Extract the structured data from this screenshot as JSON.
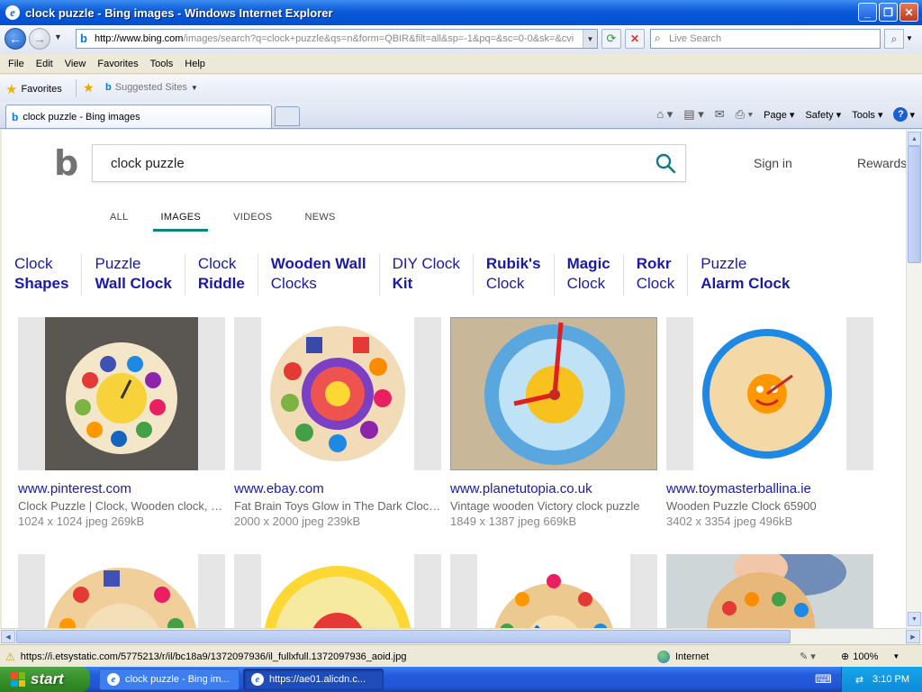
{
  "window": {
    "title": "clock puzzle - Bing images - Windows Internet Explorer",
    "buttons": [
      "minimize",
      "maximize",
      "close"
    ]
  },
  "address_bar": {
    "domain": "http://www.bing.com",
    "path": "/images/search?q=clock+puzzle&qs=n&form=QBIR&filt=all&sp=-1&pq=&sc=0-0&sk=&cvi",
    "live_search_placeholder": "Live Search"
  },
  "menu": [
    "File",
    "Edit",
    "View",
    "Favorites",
    "Tools",
    "Help"
  ],
  "favorites_bar": {
    "favorites_label": "Favorites",
    "suggested_sites": "Suggested Sites"
  },
  "tab": {
    "title": "clock puzzle - Bing images"
  },
  "command_bar": {
    "page": "Page",
    "safety": "Safety",
    "tools": "Tools"
  },
  "bing": {
    "query": "clock puzzle",
    "sign_in": "Sign in",
    "rewards": "Rewards",
    "scopes": [
      "ALL",
      "IMAGES",
      "VIDEOS",
      "NEWS"
    ],
    "active_scope": "IMAGES",
    "related": [
      {
        "line1": "Clock",
        "line2": "Shapes",
        "bold": "line2"
      },
      {
        "line1": "Puzzle",
        "line2": "Wall Clock",
        "bold": "line2"
      },
      {
        "line1": "Clock",
        "line2": "Riddle",
        "bold": "line2"
      },
      {
        "line1": "Wooden Wall",
        "line2": "Clocks",
        "bold": "line1"
      },
      {
        "line1": "DIY Clock",
        "line2": "Kit",
        "bold": "line2"
      },
      {
        "line1": "Rubik's",
        "line2": "Clock",
        "bold": "line1"
      },
      {
        "line1": "Magic",
        "line2": "Clock",
        "bold": "line1"
      },
      {
        "line1": "Rokr",
        "line2": "Clock",
        "bold": "line1"
      },
      {
        "line1": "Puzzle",
        "line2": "Alarm Clock",
        "bold": "line2"
      }
    ],
    "results": [
      {
        "site": "www.pinterest.com",
        "caption": "Clock Puzzle | Clock, Wooden clock, Clock puzzle",
        "meta": "1024 x 1024 jpeg 269kB"
      },
      {
        "site": "www.ebay.com",
        "caption": "Fat Brain Toys Glow in The Dark Clock Puzzle",
        "meta": "2000 x 2000 jpeg 239kB"
      },
      {
        "site": "www.planetutopia.co.uk",
        "caption": "Vintage wooden Victory clock puzzle",
        "meta": "1849 x 1387 jpeg 669kB"
      },
      {
        "site": "www.toymasterballina.ie",
        "caption": "Wooden Puzzle Clock 65900",
        "meta": "3402 x 3354 jpeg 496kB"
      }
    ]
  },
  "status_bar": {
    "url": "https://i.etsystatic.com/5775213/r/il/bc18a9/1372097936/il_fullxfull.1372097936_aoid.jpg",
    "zone": "Internet",
    "zoom": "100%"
  },
  "taskbar": {
    "start": "start",
    "items": [
      "clock puzzle - Bing im...",
      "https://ae01.alicdn.c..."
    ],
    "time": "3:10 PM"
  },
  "colors": {
    "bing_link": "#1a1aa6",
    "scope_underline": "#0c8484",
    "xp_blue": "#0a5ad8",
    "start_green": "#36922a"
  }
}
